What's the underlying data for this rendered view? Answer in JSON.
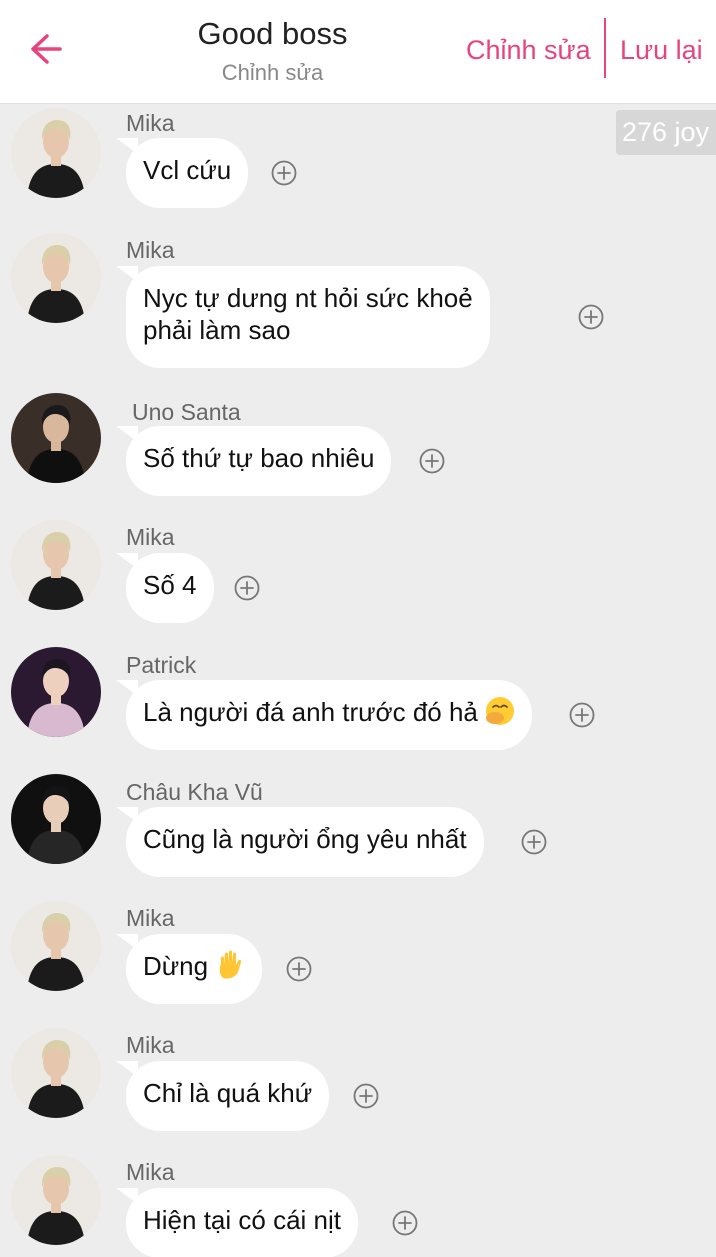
{
  "header": {
    "title": "Good boss",
    "subtitle": "Chỉnh sửa",
    "edit_label": "Chỉnh sửa",
    "save_label": "Lưu lại",
    "accent": "#e8437f"
  },
  "joy_badge": "276 joy",
  "messages": [
    {
      "name": "Mika",
      "lines": [
        "Vcl cứu"
      ],
      "emoji": null
    },
    {
      "name": "Mika",
      "lines": [
        "Nyc tự dưng nt hỏi sức khoẻ",
        "phải làm sao"
      ],
      "emoji": null
    },
    {
      "name": "Uno Santa",
      "lines": [
        "Số thứ tự bao nhiêu"
      ],
      "emoji": null
    },
    {
      "name": "Mika",
      "lines": [
        "Số 4"
      ],
      "emoji": null
    },
    {
      "name": "Patrick",
      "lines": [
        "Là người đá anh trước đó hả"
      ],
      "emoji": "hand-over-mouth-emoji"
    },
    {
      "name": "Châu Kha Vũ",
      "lines": [
        "Cũng là người ổng yêu nhất"
      ],
      "emoji": null
    },
    {
      "name": "Mika",
      "lines": [
        "Dừng"
      ],
      "emoji": "raised-hand-emoji"
    },
    {
      "name": "Mika",
      "lines": [
        "Chỉ là quá khứ"
      ],
      "emoji": null
    },
    {
      "name": "Mika",
      "lines": [
        "Hiện tại có cái nịt"
      ],
      "emoji": null
    }
  ]
}
